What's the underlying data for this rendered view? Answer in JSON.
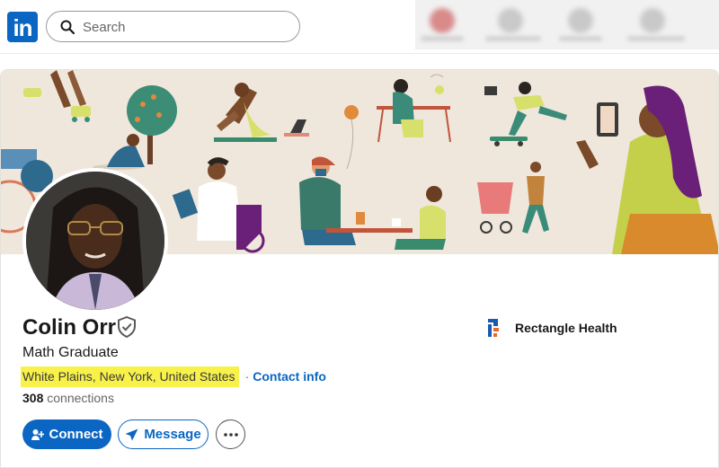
{
  "nav": {
    "logo_text": "in",
    "search_placeholder": "Search"
  },
  "profile": {
    "name": "Colin Orr",
    "headline": "Math Graduate",
    "location": "White Plains, New York, United States",
    "separator": "·",
    "contact_label": "Contact info",
    "connections_count": "308",
    "connections_label": "connections",
    "company": "Rectangle Health"
  },
  "actions": {
    "connect_label": "Connect",
    "message_label": "Message"
  },
  "colors": {
    "brand_blue": "#0a66c2",
    "highlight_yellow": "#f7f14a",
    "banner_bg": "#efe7db"
  },
  "icons": [
    "search-icon",
    "verified-shield-icon",
    "add-person-icon",
    "send-icon",
    "more-icon",
    "rectangle-health-logo-icon"
  ]
}
